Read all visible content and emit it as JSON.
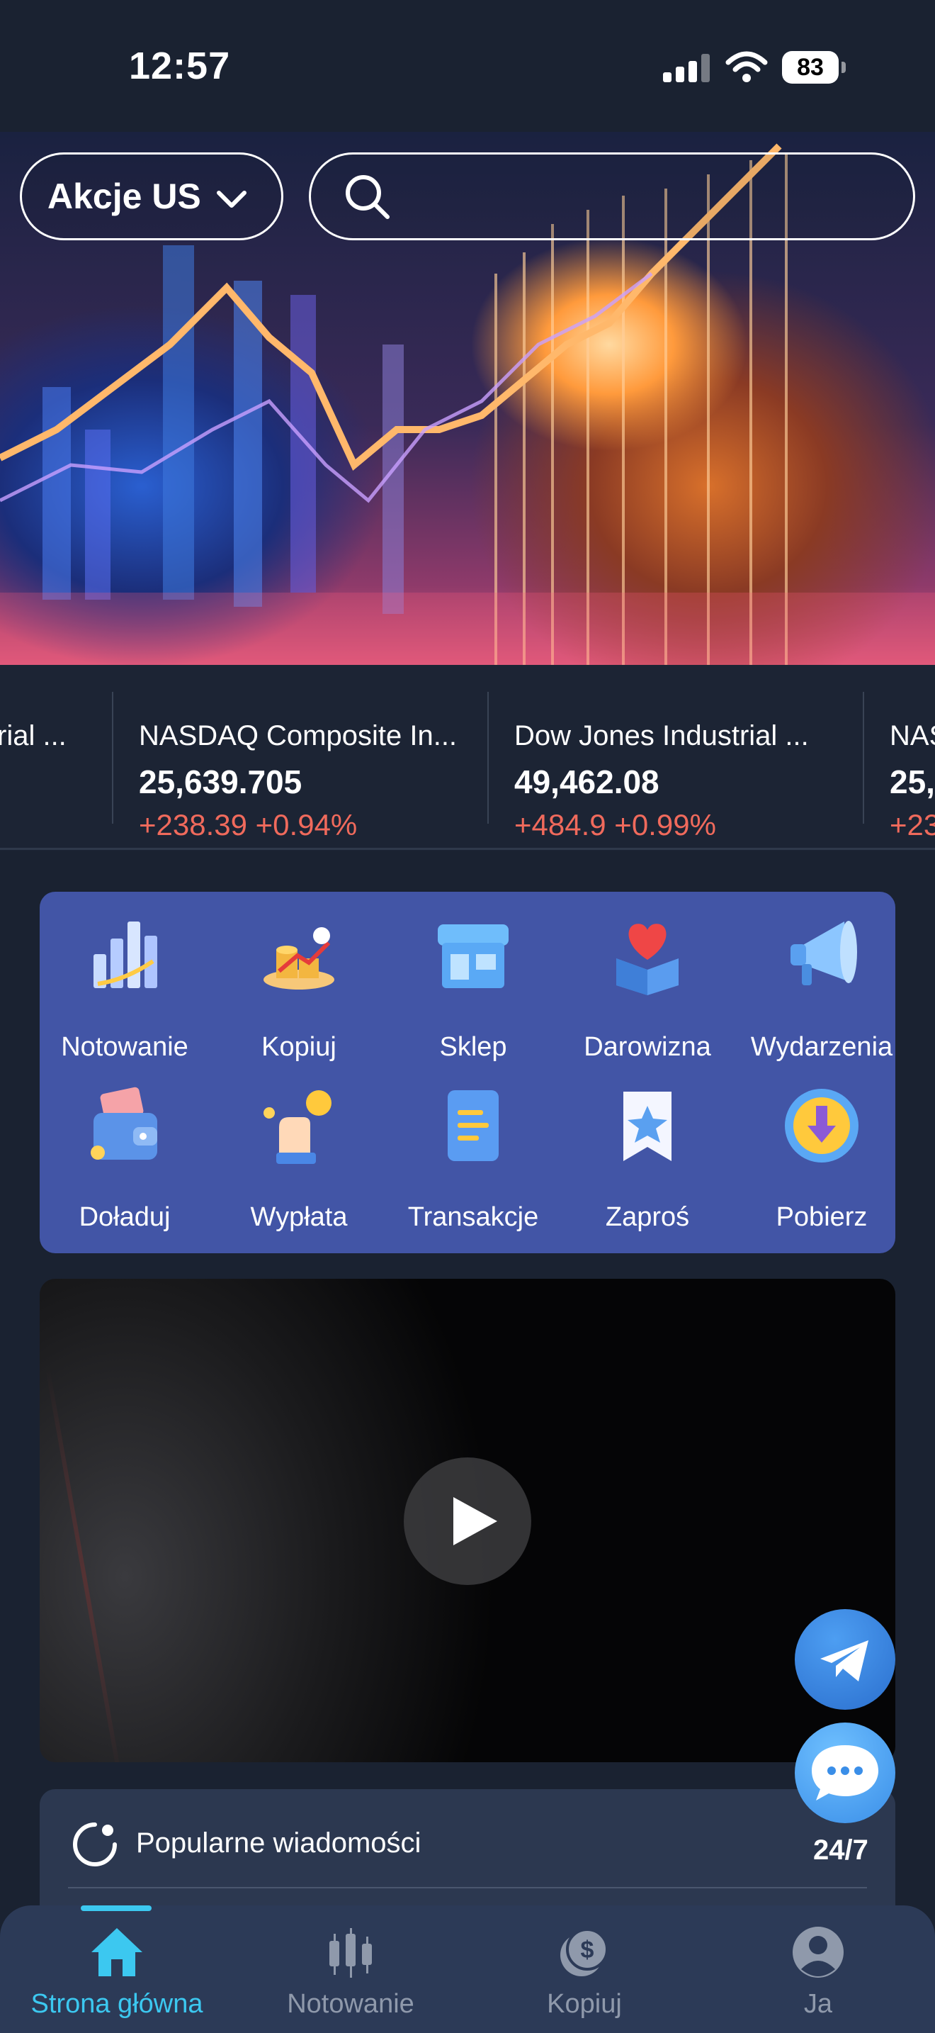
{
  "status_bar": {
    "time": "12:57",
    "battery": "83"
  },
  "header": {
    "market_selector": "Akcje US",
    "search_placeholder": ""
  },
  "tickers": [
    {
      "name": "rial ...",
      "value": "",
      "change": ""
    },
    {
      "name": "NASDAQ Composite In...",
      "value": "25,639.705",
      "change": "+238.39 +0.94%"
    },
    {
      "name": "Dow Jones Industrial ...",
      "value": "49,462.08",
      "change": "+484.9 +0.99%"
    },
    {
      "name": "NAS",
      "value": "25,",
      "change": "+23"
    }
  ],
  "quick_menu": [
    {
      "label": "Notowanie",
      "icon": "chart-bars-icon"
    },
    {
      "label": "Kopiuj",
      "icon": "coins-icon"
    },
    {
      "label": "Sklep",
      "icon": "shop-icon"
    },
    {
      "label": "Darowizna",
      "icon": "heart-box-icon"
    },
    {
      "label": "Wydarzenia",
      "icon": "megaphone-icon"
    },
    {
      "label": "Doładuj",
      "icon": "wallet-icon"
    },
    {
      "label": "Wypłata",
      "icon": "hand-coin-icon"
    },
    {
      "label": "Transakcje",
      "icon": "document-icon"
    },
    {
      "label": "Zaproś",
      "icon": "star-badge-icon"
    },
    {
      "label": "Pobierz",
      "icon": "download-icon"
    }
  ],
  "news": {
    "title": "Popularne wiadomości"
  },
  "support": {
    "label": "24/7"
  },
  "bottom_nav": [
    {
      "label": "Strona główna",
      "icon": "home-icon",
      "active": true
    },
    {
      "label": "Notowanie",
      "icon": "candlestick-icon",
      "active": false
    },
    {
      "label": "Kopiuj",
      "icon": "copy-coin-icon",
      "active": false
    },
    {
      "label": "Ja",
      "icon": "user-icon",
      "active": false
    }
  ],
  "colors": {
    "background": "#1a2231",
    "accent": "#3cc8f0",
    "change_positive": "#f06a5c",
    "quick_menu_bg": "#4255a6"
  }
}
